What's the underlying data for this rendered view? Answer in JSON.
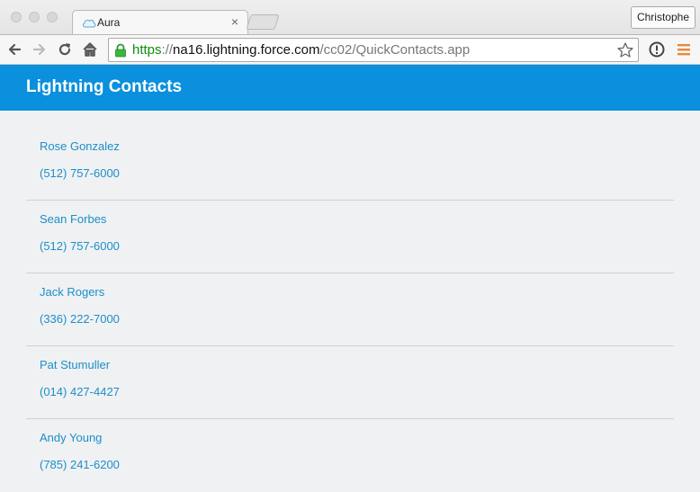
{
  "browser": {
    "tab_title": "Aura",
    "tab_close": "×",
    "profile_name": "Christophe",
    "url_scheme": "https",
    "url_sep": "://",
    "url_host": "na16.lightning.force.com",
    "url_path": "/cc02/QuickContacts.app"
  },
  "app": {
    "title": "Lightning Contacts",
    "accent_color": "#0a90dc",
    "link_color": "#1b8fc9"
  },
  "contacts": [
    {
      "name": "Rose Gonzalez",
      "phone": "(512) 757-6000"
    },
    {
      "name": "Sean Forbes",
      "phone": "(512) 757-6000"
    },
    {
      "name": "Jack Rogers",
      "phone": "(336) 222-7000"
    },
    {
      "name": "Pat Stumuller",
      "phone": "(014) 427-4427"
    },
    {
      "name": "Andy Young",
      "phone": "(785) 241-6200"
    }
  ]
}
